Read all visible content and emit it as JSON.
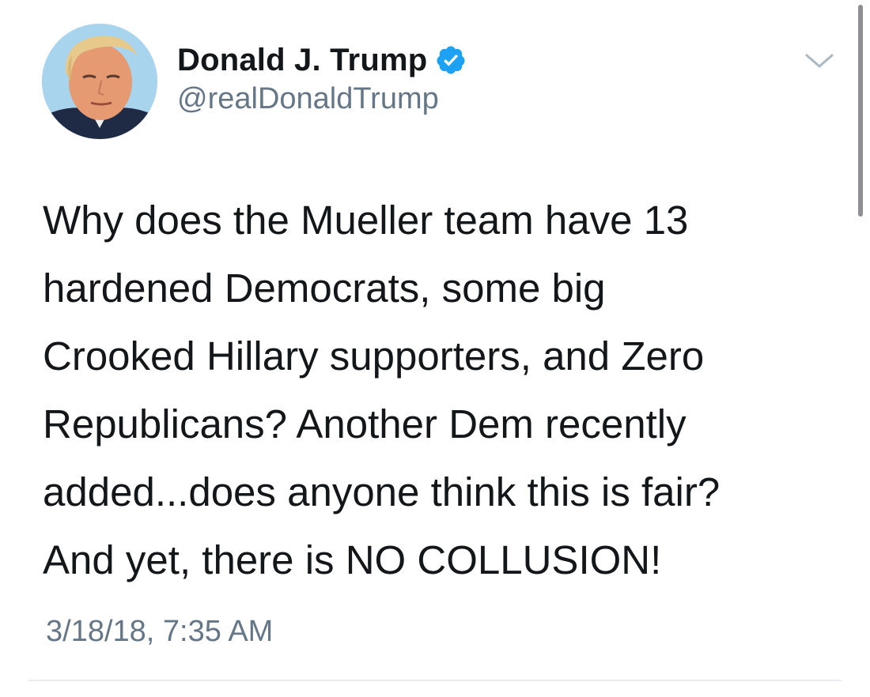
{
  "author": {
    "name": "Donald J. Trump",
    "handle": "@realDonaldTrump",
    "verified": true,
    "avatar_icon": "profile-photo"
  },
  "tweet": {
    "lines": [
      "Why does the Mueller team have 13",
      "hardened Democrats, some big",
      "Crooked Hillary supporters, and Zero",
      "Republicans? Another Dem recently",
      "added...does anyone think this is fair?",
      "And yet, there is NO COLLUSION!"
    ],
    "timestamp": "3/18/18, 7:35 AM"
  },
  "icons": {
    "verified": "verified-badge-icon",
    "menu": "chevron-down-icon"
  },
  "colors": {
    "text": "#14171a",
    "secondary": "#657786",
    "verified_blue": "#1da1f2",
    "divider": "#e6ecf0"
  }
}
